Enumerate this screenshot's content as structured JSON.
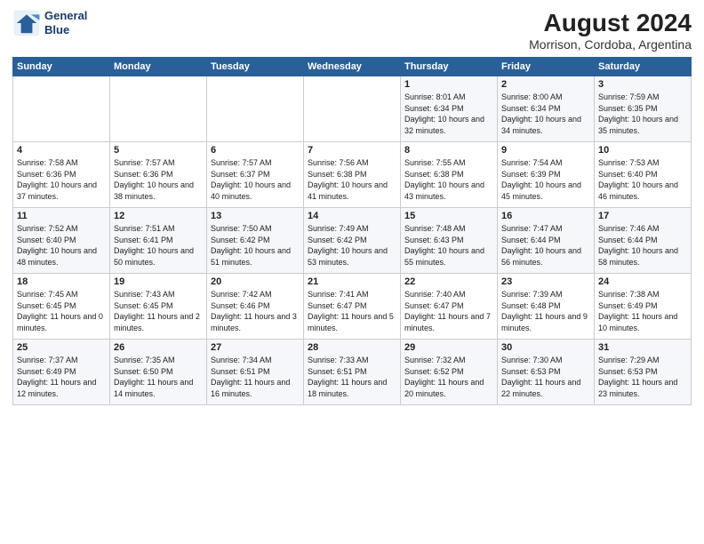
{
  "header": {
    "logo_line1": "General",
    "logo_line2": "Blue",
    "title": "August 2024",
    "subtitle": "Morrison, Cordoba, Argentina"
  },
  "days_of_week": [
    "Sunday",
    "Monday",
    "Tuesday",
    "Wednesday",
    "Thursday",
    "Friday",
    "Saturday"
  ],
  "weeks": [
    [
      {
        "day": "",
        "sunrise": "",
        "sunset": "",
        "daylight": ""
      },
      {
        "day": "",
        "sunrise": "",
        "sunset": "",
        "daylight": ""
      },
      {
        "day": "",
        "sunrise": "",
        "sunset": "",
        "daylight": ""
      },
      {
        "day": "",
        "sunrise": "",
        "sunset": "",
        "daylight": ""
      },
      {
        "day": "1",
        "sunrise": "8:01 AM",
        "sunset": "6:34 PM",
        "daylight": "10 hours and 32 minutes."
      },
      {
        "day": "2",
        "sunrise": "8:00 AM",
        "sunset": "6:34 PM",
        "daylight": "10 hours and 34 minutes."
      },
      {
        "day": "3",
        "sunrise": "7:59 AM",
        "sunset": "6:35 PM",
        "daylight": "10 hours and 35 minutes."
      }
    ],
    [
      {
        "day": "4",
        "sunrise": "7:58 AM",
        "sunset": "6:36 PM",
        "daylight": "10 hours and 37 minutes."
      },
      {
        "day": "5",
        "sunrise": "7:57 AM",
        "sunset": "6:36 PM",
        "daylight": "10 hours and 38 minutes."
      },
      {
        "day": "6",
        "sunrise": "7:57 AM",
        "sunset": "6:37 PM",
        "daylight": "10 hours and 40 minutes."
      },
      {
        "day": "7",
        "sunrise": "7:56 AM",
        "sunset": "6:38 PM",
        "daylight": "10 hours and 41 minutes."
      },
      {
        "day": "8",
        "sunrise": "7:55 AM",
        "sunset": "6:38 PM",
        "daylight": "10 hours and 43 minutes."
      },
      {
        "day": "9",
        "sunrise": "7:54 AM",
        "sunset": "6:39 PM",
        "daylight": "10 hours and 45 minutes."
      },
      {
        "day": "10",
        "sunrise": "7:53 AM",
        "sunset": "6:40 PM",
        "daylight": "10 hours and 46 minutes."
      }
    ],
    [
      {
        "day": "11",
        "sunrise": "7:52 AM",
        "sunset": "6:40 PM",
        "daylight": "10 hours and 48 minutes."
      },
      {
        "day": "12",
        "sunrise": "7:51 AM",
        "sunset": "6:41 PM",
        "daylight": "10 hours and 50 minutes."
      },
      {
        "day": "13",
        "sunrise": "7:50 AM",
        "sunset": "6:42 PM",
        "daylight": "10 hours and 51 minutes."
      },
      {
        "day": "14",
        "sunrise": "7:49 AM",
        "sunset": "6:42 PM",
        "daylight": "10 hours and 53 minutes."
      },
      {
        "day": "15",
        "sunrise": "7:48 AM",
        "sunset": "6:43 PM",
        "daylight": "10 hours and 55 minutes."
      },
      {
        "day": "16",
        "sunrise": "7:47 AM",
        "sunset": "6:44 PM",
        "daylight": "10 hours and 56 minutes."
      },
      {
        "day": "17",
        "sunrise": "7:46 AM",
        "sunset": "6:44 PM",
        "daylight": "10 hours and 58 minutes."
      }
    ],
    [
      {
        "day": "18",
        "sunrise": "7:45 AM",
        "sunset": "6:45 PM",
        "daylight": "11 hours and 0 minutes."
      },
      {
        "day": "19",
        "sunrise": "7:43 AM",
        "sunset": "6:45 PM",
        "daylight": "11 hours and 2 minutes."
      },
      {
        "day": "20",
        "sunrise": "7:42 AM",
        "sunset": "6:46 PM",
        "daylight": "11 hours and 3 minutes."
      },
      {
        "day": "21",
        "sunrise": "7:41 AM",
        "sunset": "6:47 PM",
        "daylight": "11 hours and 5 minutes."
      },
      {
        "day": "22",
        "sunrise": "7:40 AM",
        "sunset": "6:47 PM",
        "daylight": "11 hours and 7 minutes."
      },
      {
        "day": "23",
        "sunrise": "7:39 AM",
        "sunset": "6:48 PM",
        "daylight": "11 hours and 9 minutes."
      },
      {
        "day": "24",
        "sunrise": "7:38 AM",
        "sunset": "6:49 PM",
        "daylight": "11 hours and 10 minutes."
      }
    ],
    [
      {
        "day": "25",
        "sunrise": "7:37 AM",
        "sunset": "6:49 PM",
        "daylight": "11 hours and 12 minutes."
      },
      {
        "day": "26",
        "sunrise": "7:35 AM",
        "sunset": "6:50 PM",
        "daylight": "11 hours and 14 minutes."
      },
      {
        "day": "27",
        "sunrise": "7:34 AM",
        "sunset": "6:51 PM",
        "daylight": "11 hours and 16 minutes."
      },
      {
        "day": "28",
        "sunrise": "7:33 AM",
        "sunset": "6:51 PM",
        "daylight": "11 hours and 18 minutes."
      },
      {
        "day": "29",
        "sunrise": "7:32 AM",
        "sunset": "6:52 PM",
        "daylight": "11 hours and 20 minutes."
      },
      {
        "day": "30",
        "sunrise": "7:30 AM",
        "sunset": "6:53 PM",
        "daylight": "11 hours and 22 minutes."
      },
      {
        "day": "31",
        "sunrise": "7:29 AM",
        "sunset": "6:53 PM",
        "daylight": "11 hours and 23 minutes."
      }
    ]
  ]
}
